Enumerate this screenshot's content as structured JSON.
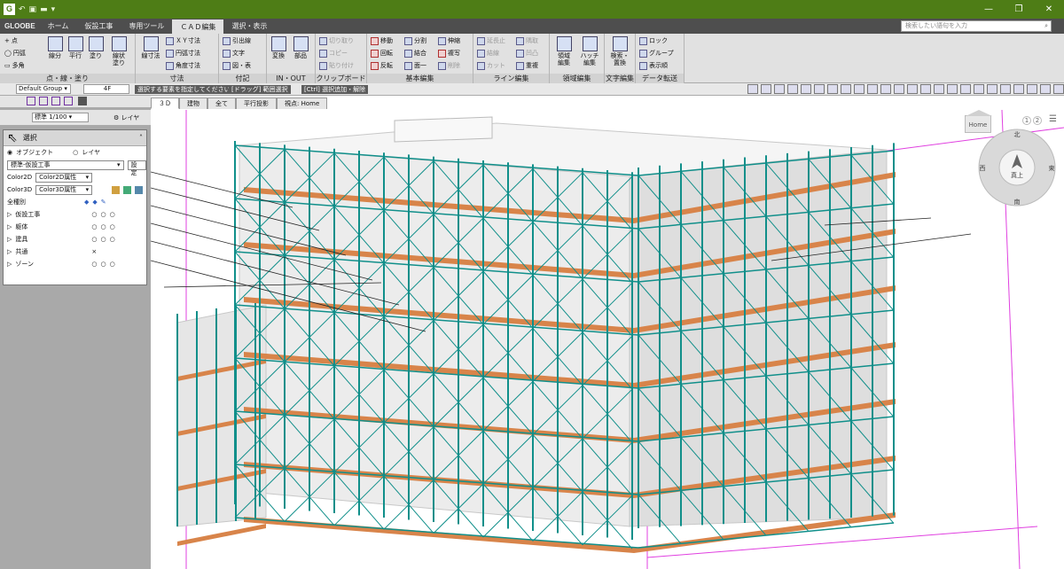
{
  "app": {
    "logo": "G",
    "quick_access": [
      "↶",
      "▣",
      "▬",
      "▾"
    ]
  },
  "window_controls": {
    "minimize": "—",
    "maximize": "❐",
    "close": "✕"
  },
  "tabs": [
    "GLOOBE",
    "ホーム",
    "仮設工事",
    "専用ツール",
    "ＣＡＤ編集",
    "選択・表示"
  ],
  "search": {
    "placeholder": "検索したい語句を入力",
    "icon": "search-icon"
  },
  "ribbon": {
    "groups": [
      {
        "label": "点・線・塗り"
      },
      {
        "label": "寸法"
      },
      {
        "label": "付記"
      },
      {
        "label": "IN・OUT"
      },
      {
        "label": "クリップボード"
      },
      {
        "label": "基本編集"
      },
      {
        "label": "ライン編集"
      },
      {
        "label": "領域編集"
      },
      {
        "label": "文字編集"
      },
      {
        "label": "データ転送"
      }
    ],
    "draw": {
      "point": "点",
      "arc": "円弧",
      "polygon": "多角",
      "segment": "線分",
      "parallel": "平行",
      "fill": "塗り",
      "line_fill": "線状\n塗り"
    },
    "dim": {
      "linear": "線寸法",
      "xy": "ＸＹ寸法",
      "arc": "円弧寸法",
      "angle": "角度寸法"
    },
    "note": {
      "leader": "引出線",
      "text": "文字",
      "figure": "図・表"
    },
    "io": {
      "convert": "変換",
      "parts": "部品"
    },
    "clip": {
      "cut": "切り取り",
      "copy": "コピー",
      "paste": "貼り付け"
    },
    "edit": {
      "move": "移動",
      "rotate": "回転",
      "mirror": "反転",
      "split": "分割",
      "join": "結合",
      "surface": "面一",
      "stretch": "伸縮",
      "duplicate": "複写",
      "delete": "削除"
    },
    "line": {
      "extend": "延長止",
      "connect": "結線",
      "cut": "カット",
      "corner": "隅取",
      "convex": "凹凸",
      "overlap": "重複"
    },
    "region": {
      "area": "領域\n編集",
      "hatch": "ハッチ\n編集"
    },
    "textedit": {
      "search_replace": "検索・\n置換"
    },
    "data": {
      "lock": "ロック",
      "group": "グループ",
      "display_order": "表示順"
    }
  },
  "option_bar": {
    "group": "Default Group",
    "floor": "4F",
    "hint1": "選択する要素を指定してください。",
    "hint2": "[ドラッグ] 範囲選択",
    "hint3": "[Ctrl] 選択追加・解除"
  },
  "left_panel": {
    "scale": "標準 1/100",
    "layer_btn": "レイヤ",
    "title": "選択",
    "modes": [
      "オブジェクト",
      "レイヤ"
    ],
    "preset": "標準-仮設工事",
    "setting_btn": "設定",
    "color2d_label": "Color2D",
    "color2d_value": "Color2D属性",
    "color3d_label": "Color3D",
    "color3d_value": "Color3D属性",
    "all_types": "全種別",
    "categories": [
      {
        "name": "仮設工事",
        "marks": [
          "○",
          "○",
          "○"
        ]
      },
      {
        "name": "躯体",
        "marks": [
          "○",
          "○",
          "○"
        ]
      },
      {
        "name": "建具",
        "marks": [
          "○",
          "○",
          "○"
        ]
      },
      {
        "name": "共通",
        "marks": [
          "×",
          "",
          ""
        ]
      },
      {
        "name": "ゾーン",
        "marks": [
          "○",
          "○",
          "○"
        ]
      }
    ]
  },
  "view_tabs": [
    "３Ｄ",
    "建物",
    "全て",
    "平行投影",
    "視点: Home"
  ],
  "viewcube": {
    "home": "Home",
    "pages": [
      "1",
      "2"
    ],
    "north": "北",
    "south": "南",
    "east": "東",
    "west": "西",
    "top": "真上"
  },
  "colors": {
    "scaffold": "#108f8a",
    "plank": "#d8844a",
    "titlebar": "#4e7d16",
    "grid": "#e040e0"
  }
}
